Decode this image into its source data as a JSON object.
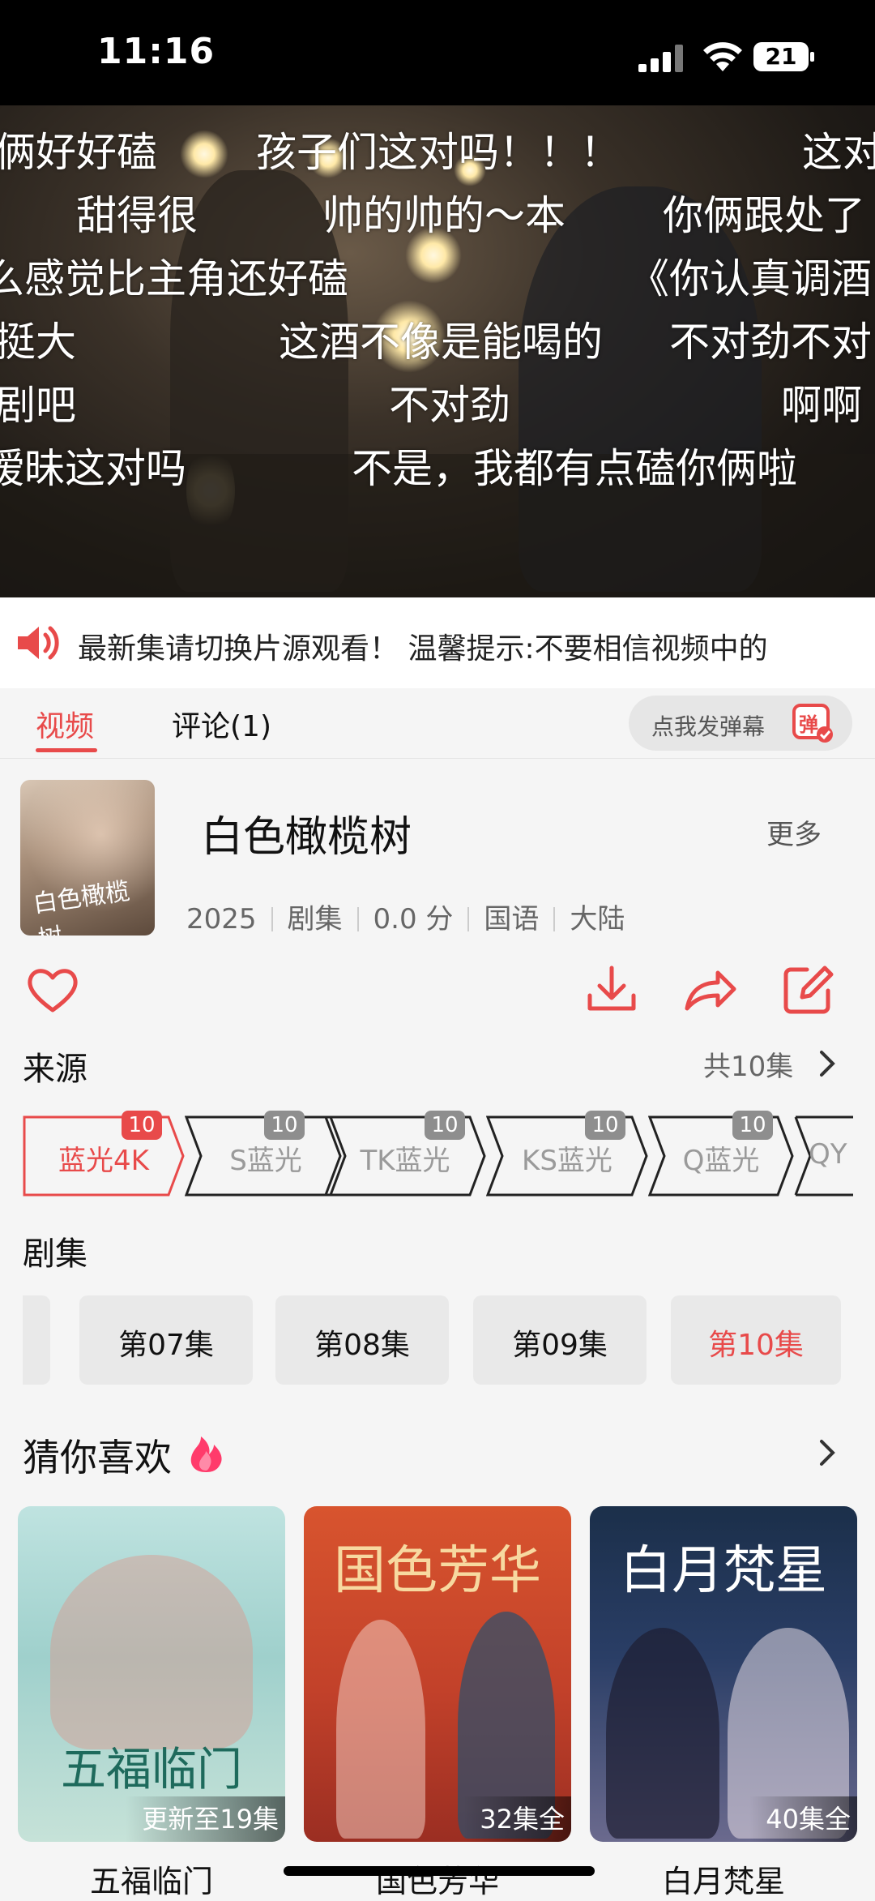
{
  "status_bar": {
    "time": "11:16",
    "battery": "21"
  },
  "video": {
    "danmaku": [
      "俩好好磕",
      "孩子们这对吗！！！",
      "这对",
      "甜得很",
      "帅的帅的～本",
      "你俩跟处了",
      "么感觉比主角还好磕",
      "《你认真调酒",
      "挺大",
      "这酒不像是能喝的",
      "不对劲不对",
      "剧吧",
      "不对劲",
      "啊啊",
      "暧昧这对吗",
      "不是，我都有点磕你俩啦"
    ]
  },
  "notice": {
    "text": "最新集请切换片源观看！       温馨提示:不要相信视频中的"
  },
  "tabs": {
    "video": "视频",
    "comment": "评论(1)",
    "danmu_placeholder": "点我发弹幕",
    "danmu_icon_text": "弹"
  },
  "show": {
    "title": "白色橄榄树",
    "more": "更多",
    "poster_text": "白色橄榄树",
    "year": "2025",
    "type": "剧集",
    "score": "0.0 分",
    "language": "国语",
    "region": "大陆"
  },
  "source": {
    "heading": "来源",
    "total": "共10集",
    "items": [
      {
        "label": "蓝光4K",
        "count": "10"
      },
      {
        "label": "S蓝光",
        "count": "10"
      },
      {
        "label": "TK蓝光",
        "count": "10"
      },
      {
        "label": "KS蓝光",
        "count": "10"
      },
      {
        "label": "Q蓝光",
        "count": "10"
      },
      {
        "label": "QY",
        "count": ""
      }
    ]
  },
  "episodes": {
    "heading": "剧集",
    "items": [
      "第07集",
      "第08集",
      "第09集",
      "第10集"
    ],
    "active": "第10集"
  },
  "recommend": {
    "heading": "猜你喜欢",
    "items": [
      {
        "name": "五福临门",
        "tag": "更新至19集",
        "art": "五福临门"
      },
      {
        "name": "国色芳华",
        "tag": "32集全",
        "art": "国色芳华"
      },
      {
        "name": "白月梵星",
        "tag": "40集全",
        "art": "白月梵星"
      }
    ]
  },
  "colors": {
    "accent": "#e84a4a"
  }
}
